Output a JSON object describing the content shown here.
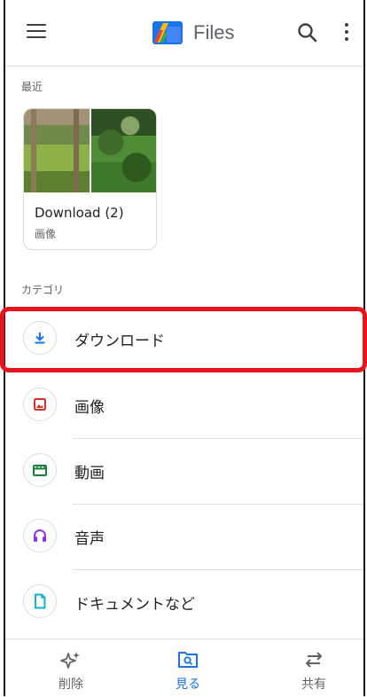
{
  "app": {
    "title": "Files"
  },
  "recent": {
    "label": "最近",
    "card": {
      "title": "Download (2)",
      "subtitle": "画像"
    }
  },
  "categories": {
    "label": "カテゴリ",
    "items": [
      {
        "label": "ダウンロード",
        "icon": "download-icon",
        "color": "#1a73e8"
      },
      {
        "label": "画像",
        "icon": "image-icon",
        "color": "#d93025"
      },
      {
        "label": "動画",
        "icon": "video-icon",
        "color": "#188038"
      },
      {
        "label": "音声",
        "icon": "headphones-icon",
        "color": "#9334e6"
      },
      {
        "label": "ドキュメントなど",
        "icon": "document-icon",
        "color": "#12b5cb"
      }
    ]
  },
  "bottom_nav": {
    "items": [
      {
        "label": "削除",
        "icon": "sparkle-icon",
        "active": false
      },
      {
        "label": "見る",
        "icon": "browse-icon",
        "active": true
      },
      {
        "label": "共有",
        "icon": "swap-arrows-icon",
        "active": false
      }
    ]
  },
  "colors": {
    "accent": "#1a73e8",
    "highlight": "#e8141c"
  }
}
